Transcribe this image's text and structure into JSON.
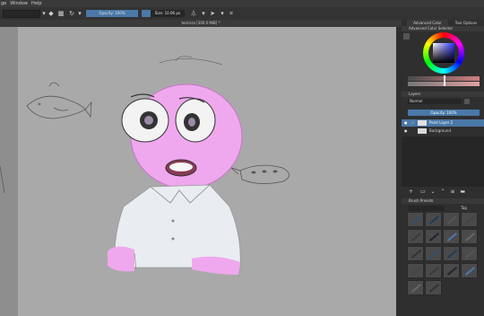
{
  "menu": {
    "items": [
      "ge",
      "Window",
      "Help"
    ]
  },
  "toolbar": {
    "opacity_label": "Opacity: 100%",
    "size_label": "Size: 10.06 px"
  },
  "document": {
    "title": "test.kra [300.0 MiB] *"
  },
  "dockers": {
    "tabs": [
      "Advanced Color Selector",
      "Tool Options"
    ],
    "color_selector_title": "Advanced Color Selector",
    "layers_title": "Layers",
    "blending_mode": "Normal",
    "layer_opacity": "Opacity: 100%",
    "layers": [
      {
        "name": "Paint Layer 2",
        "selected": true
      },
      {
        "name": "Background",
        "selected": false
      }
    ],
    "brush_presets_title": "Brush Presets",
    "brush_tag_label": "Tag",
    "brush_count": 18
  },
  "colors": {
    "accent": "#4a78a8",
    "canvas_bg": "#9a9a9a",
    "face_pink": "#eeaaee",
    "shirt": "#e8ecf0"
  }
}
